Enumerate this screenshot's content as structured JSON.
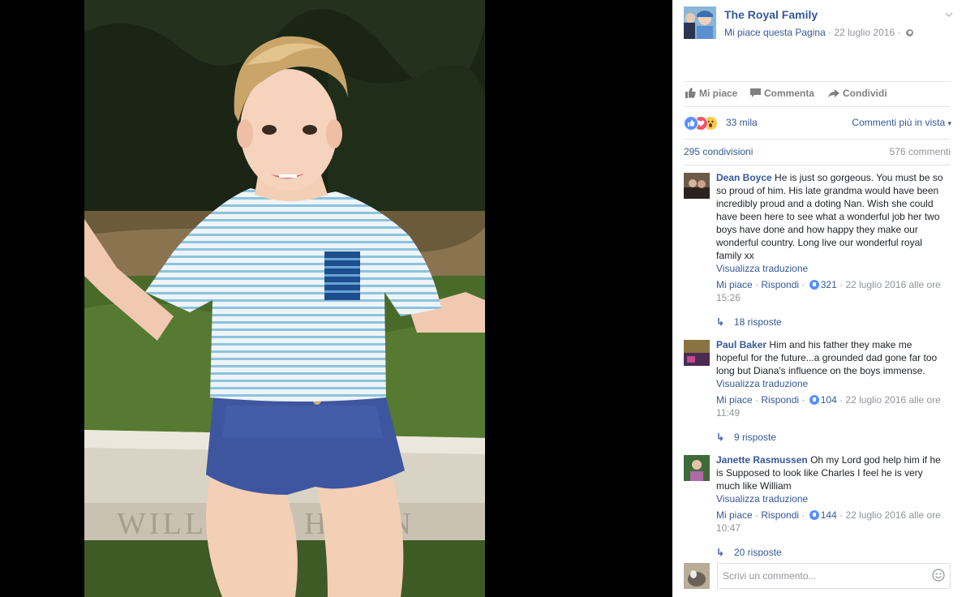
{
  "post": {
    "page_name": "The Royal Family",
    "liked_label": "Mi piace questa Pagina",
    "separator": " · ",
    "date": "22 luglio 2016",
    "dot": " · "
  },
  "actions": {
    "like": "Mi piace",
    "comment": "Commenta",
    "share": "Condividi"
  },
  "reactions": {
    "count": "33 mila",
    "sort": "Commenti più in vista",
    "sort_arrow": "▾",
    "types": [
      "like-icon",
      "love-icon",
      "wow-icon"
    ]
  },
  "stats": {
    "shares": "295 condivisioni",
    "comments": "576 commenti"
  },
  "comments": [
    {
      "author": "Dean Boyce",
      "text": "He is just so gorgeous. You must be so so proud of him. His late grandma would have been incredibly proud and a doting Nan. Wish she could have been here to see what a wonderful job her two boys have done and how happy they make our wonderful country. Long live our wonderful royal family xx",
      "translate": "Visualizza traduzione",
      "like": "Mi piace",
      "reply": "Rispondi",
      "likes": "321",
      "time": "22 luglio 2016 alle ore 15:26",
      "replies": "18 risposte"
    },
    {
      "author": "Paul Baker",
      "text": "Him and his father they make me hopeful for the future...a grounded dad gone far too long but Diana's influence on the boys immense.",
      "translate": "Visualizza traduzione",
      "like": "Mi piace",
      "reply": "Rispondi",
      "likes": "104",
      "time": "22 luglio 2016 alle ore 11:49",
      "replies": "9 risposte"
    },
    {
      "author": "Janette Rasmussen",
      "text": "Oh my Lord god help him if he is Supposed to look like Charles I feel he is very much like William",
      "translate": "Visualizza traduzione",
      "like": "Mi piace",
      "reply": "Rispondi",
      "likes": "144",
      "time": "22 luglio 2016 alle ore 10:47",
      "replies": "20 risposte"
    }
  ],
  "composer": {
    "placeholder": "Scrivi un commento..."
  },
  "photo": {
    "bench_inscription": "WILLI & C   HERIN"
  },
  "colors": {
    "link": "#365899",
    "like_blue": "#5890ff",
    "love_red": "#f25268",
    "wow_yellow": "#f7c945"
  }
}
